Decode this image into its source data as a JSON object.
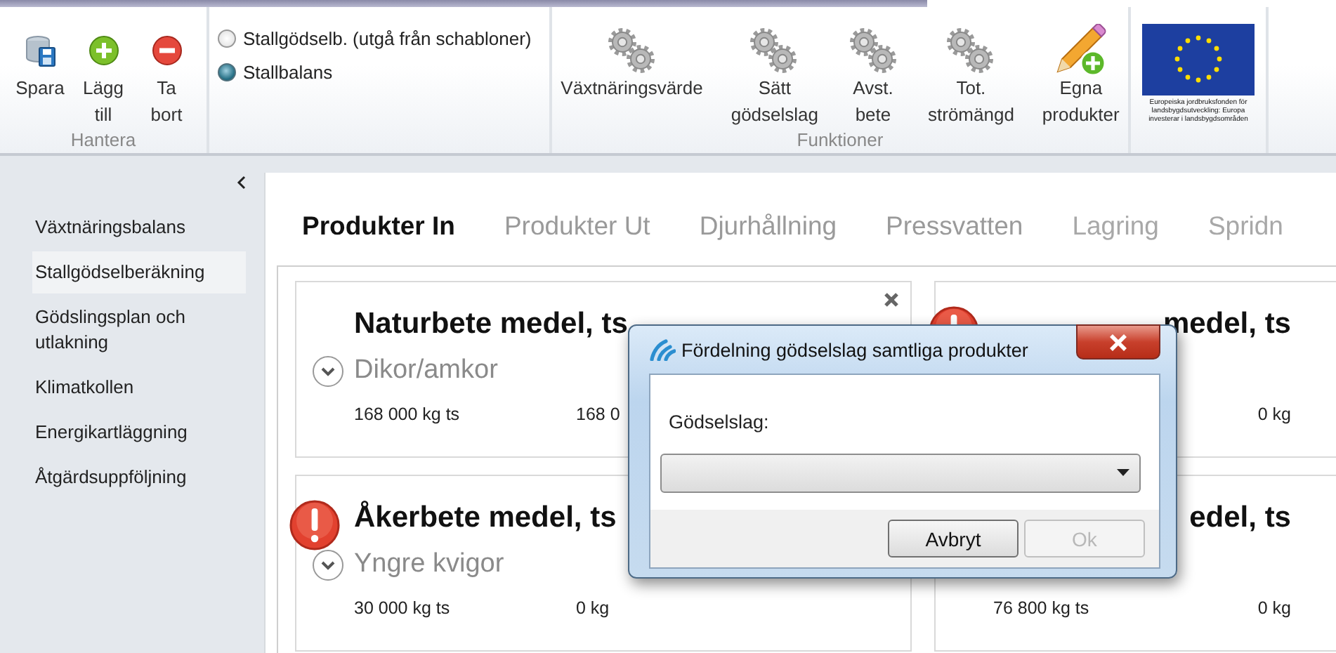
{
  "ribbon": {
    "groups": [
      {
        "kind": "buttons",
        "label": "Hantera",
        "buttons": [
          {
            "label": "Spara",
            "kind": "save"
          },
          {
            "label": "Lägg till",
            "kind": "add"
          },
          {
            "label": "Ta bort",
            "kind": "remove"
          }
        ]
      },
      {
        "kind": "radios",
        "options": [
          {
            "label": "Stallgödselb. (utgå från schabloner)",
            "selected": false
          },
          {
            "label": "Stallbalans",
            "selected": true
          }
        ]
      },
      {
        "kind": "buttons",
        "label": "Funktioner",
        "buttons": [
          {
            "label": "Växtnäringsvärde",
            "kind": "gears"
          },
          {
            "label": "Sätt gödselslag",
            "kind": "gears"
          },
          {
            "label": "Avst. bete",
            "kind": "gears"
          },
          {
            "label": "Tot. strömängd",
            "kind": "gears"
          },
          {
            "label": "Egna produkter",
            "kind": "pencil"
          }
        ]
      },
      {
        "kind": "logo",
        "caption_lines": [
          "Europeiska jordbruksfonden för",
          "landsbygdsutveckling: Europa",
          "investerar i landsbygdsområden"
        ]
      }
    ]
  },
  "sidebar": {
    "items": [
      {
        "label": "Växtnäringsbalans",
        "selected": false
      },
      {
        "label": "Stallgödselberäkning",
        "selected": true
      },
      {
        "label": "Gödslingsplan och utlakning",
        "selected": false
      },
      {
        "label": "Klimatkollen",
        "selected": false
      },
      {
        "label": "Energikartläggning",
        "selected": false
      },
      {
        "label": "Åtgärdsuppföljning",
        "selected": false
      }
    ]
  },
  "tabs": [
    {
      "label": "Produkter In",
      "selected": true,
      "disabled": false
    },
    {
      "label": "Produkter Ut",
      "selected": false,
      "disabled": false
    },
    {
      "label": "Djurhållning",
      "selected": false,
      "disabled": false
    },
    {
      "label": "Pressvatten",
      "selected": false,
      "disabled": false
    },
    {
      "label": "Lagring",
      "selected": false,
      "disabled": true
    },
    {
      "label": "Spridn",
      "selected": false,
      "disabled": true
    }
  ],
  "cards": [
    {
      "title": "Naturbete medel, ts",
      "subtitle": "Dikor/amkor",
      "column_1": "168 000 kg ts",
      "column_2": "168 0",
      "closable": true
    },
    {
      "title": "medel, ts",
      "column_2": "0 kg",
      "warning": true
    },
    {
      "title": "Åkerbete medel, ts",
      "subtitle": "Yngre kvigor",
      "column_1": "30 000 kg ts",
      "column_2": "0 kg",
      "warning": true
    },
    {
      "title": "edel, ts",
      "column_1": "76 800 kg ts",
      "column_2": "0 kg"
    }
  ],
  "dialog": {
    "title": "Fördelning gödselslag samtliga produkter",
    "field_label": "Gödselslag:",
    "buttons": [
      {
        "label": "Avbryt",
        "disabled": false
      },
      {
        "label": "Ok",
        "disabled": true
      }
    ]
  }
}
